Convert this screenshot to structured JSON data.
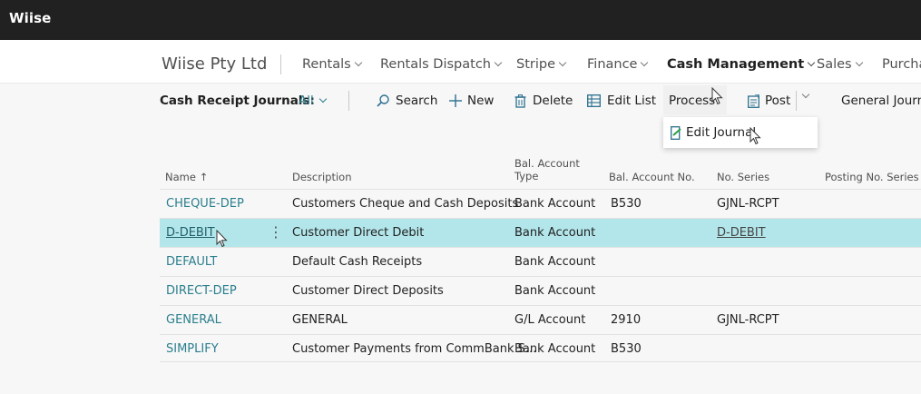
{
  "app": {
    "brand": "Wiise"
  },
  "nav": {
    "company": "Wiise Pty Ltd",
    "items": [
      "Rentals",
      "Rentals Dispatch",
      "Stripe",
      "Finance",
      "Cash Management",
      "Sales",
      "Purcha"
    ],
    "active": "Cash Management"
  },
  "actions": {
    "filter_label": "Cash Receipt Journals:",
    "filter_value": "All",
    "search": "Search",
    "new": "New",
    "delete": "Delete",
    "edit_list": "Edit List",
    "process": "Process",
    "post": "Post",
    "general_journal": "General Journal"
  },
  "dropdown": {
    "edit_journal": "Edit Journal"
  },
  "table": {
    "headers": {
      "name": "Name",
      "sort_indicator": "↑",
      "description": "Description",
      "bal_type_1": "Bal. Account",
      "bal_type_2": "Type",
      "bal_no": "Bal. Account No.",
      "no_series": "No. Series",
      "posting_no_series": "Posting No. Series"
    },
    "rows": [
      {
        "name": "CHEQUE-DEP",
        "description": "Customers Cheque and Cash Deposits",
        "type": "Bank Account",
        "bal_no": "B530",
        "no_series": "GJNL-RCPT"
      },
      {
        "name": "D-DEBIT",
        "description": "Customer Direct Debit",
        "type": "Bank Account",
        "bal_no": "",
        "no_series": "D-DEBIT"
      },
      {
        "name": "DEFAULT",
        "description": "Default Cash Receipts",
        "type": "Bank Account",
        "bal_no": "",
        "no_series": ""
      },
      {
        "name": "DIRECT-DEP",
        "description": "Customer Direct Deposits",
        "type": "Bank Account",
        "bal_no": "",
        "no_series": ""
      },
      {
        "name": "GENERAL",
        "description": "GENERAL",
        "type": "G/L Account",
        "bal_no": "2910",
        "no_series": "GJNL-RCPT"
      },
      {
        "name": "SIMPLIFY",
        "description": "Customer Payments from CommBank S...",
        "type": "Bank Account",
        "bal_no": "B530",
        "no_series": ""
      }
    ],
    "selected_row": 1
  },
  "icons": {
    "search": "search-icon",
    "new": "plus-icon",
    "delete": "trash-icon",
    "edit_list": "edit-list-icon",
    "post": "post-icon",
    "edit_journal": "edit-journal-icon",
    "more": "more-options-icon",
    "cursor": "mouse-cursor-icon"
  },
  "colors": {
    "topbar": "#212121",
    "accent": "#2b7f8e",
    "selected_row": "#b3e6ea"
  }
}
